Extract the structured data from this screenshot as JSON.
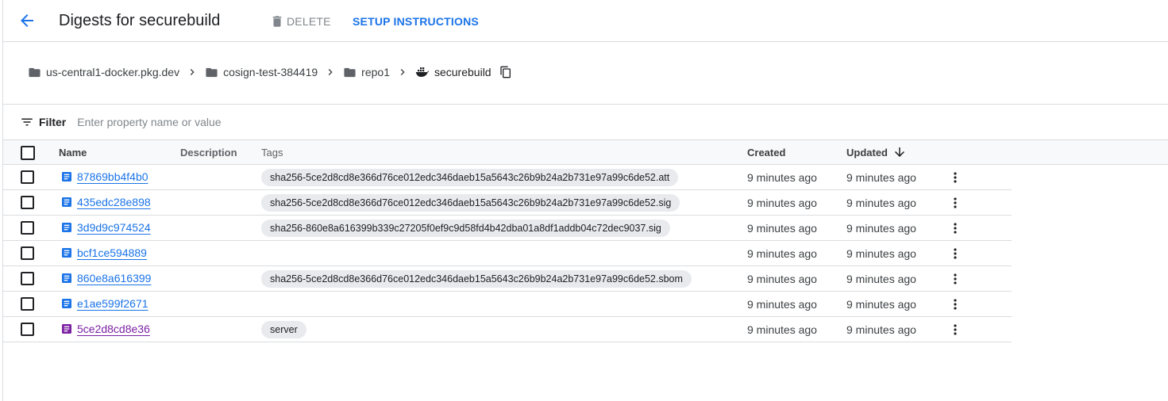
{
  "header": {
    "title": "Digests for securebuild",
    "delete_label": "DELETE",
    "setup_label": "SETUP INSTRUCTIONS"
  },
  "breadcrumb": {
    "items": [
      {
        "label": "us-central1-docker.pkg.dev",
        "icon": "folder-icon"
      },
      {
        "label": "cosign-test-384419",
        "icon": "folder-icon"
      },
      {
        "label": "repo1",
        "icon": "folder-icon"
      },
      {
        "label": "securebuild",
        "icon": "docker-icon"
      }
    ]
  },
  "filter": {
    "label": "Filter",
    "placeholder": "Enter property name or value"
  },
  "table": {
    "columns": {
      "name": "Name",
      "description": "Description",
      "tags": "Tags",
      "created": "Created",
      "updated": "Updated"
    },
    "sort": {
      "column": "Updated",
      "direction": "descending"
    },
    "rows": [
      {
        "name": "87869bb4f4b0",
        "tag": "sha256-5ce2d8cd8e366d76ce012edc346daeb15a5643c26b9b24a2b731e97a99c6de52.att",
        "created": "9 minutes ago",
        "updated": "9 minutes ago",
        "visited": false
      },
      {
        "name": "435edc28e898",
        "tag": "sha256-5ce2d8cd8e366d76ce012edc346daeb15a5643c26b9b24a2b731e97a99c6de52.sig",
        "created": "9 minutes ago",
        "updated": "9 minutes ago",
        "visited": false
      },
      {
        "name": "3d9d9c974524",
        "tag": "sha256-860e8a616399b339c27205f0ef9c9d58fd4b42dba01a8df1addb04c72dec9037.sig",
        "created": "9 minutes ago",
        "updated": "9 minutes ago",
        "visited": false
      },
      {
        "name": "bcf1ce594889",
        "tag": "",
        "created": "9 minutes ago",
        "updated": "9 minutes ago",
        "visited": false
      },
      {
        "name": "860e8a616399",
        "tag": "sha256-5ce2d8cd8e366d76ce012edc346daeb15a5643c26b9b24a2b731e97a99c6de52.sbom",
        "created": "9 minutes ago",
        "updated": "9 minutes ago",
        "visited": false
      },
      {
        "name": "e1ae599f2671",
        "tag": "",
        "created": "9 minutes ago",
        "updated": "9 minutes ago",
        "visited": false
      },
      {
        "name": "5ce2d8cd8e36",
        "tag": "server",
        "created": "9 minutes ago",
        "updated": "9 minutes ago",
        "visited": true
      }
    ]
  },
  "colors": {
    "accent": "#1a73e8",
    "visited_link": "#7b1fa2",
    "chip_bg": "#e8eaed",
    "divider": "#dadce0"
  }
}
